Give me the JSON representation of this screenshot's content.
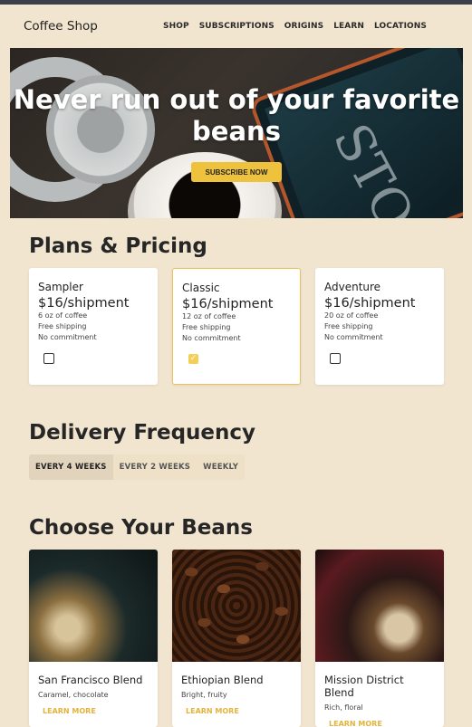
{
  "nav": {
    "brand": "Coffee Shop",
    "links": [
      "SHOP",
      "SUBSCRIPTIONS",
      "ORIGINS",
      "LEARN",
      "LOCATIONS"
    ]
  },
  "hero": {
    "headline": "Never run out of your favorite beans",
    "cta": "SUBSCRIBE NOW",
    "chalk_text": "WHAT'S YOUR STORY"
  },
  "plans": {
    "title": "Plans & Pricing",
    "items": [
      {
        "name": "Sampler",
        "price": "$16/shipment",
        "features": [
          "6 oz of coffee",
          "Free shipping",
          "No commitment"
        ],
        "selected": false
      },
      {
        "name": "Classic",
        "price": "$16/shipment",
        "features": [
          "12 oz of coffee",
          "Free shipping",
          "No commitment"
        ],
        "selected": true
      },
      {
        "name": "Adventure",
        "price": "$16/shipment",
        "features": [
          "20 oz of coffee",
          "Free shipping",
          "No commitment"
        ],
        "selected": false
      }
    ]
  },
  "frequency": {
    "title": "Delivery Frequency",
    "options": [
      "EVERY 4 WEEKS",
      "EVERY 2 WEEKS",
      "WEEKLY"
    ],
    "active": "EVERY 4 WEEKS"
  },
  "beans": {
    "title": "Choose Your Beans",
    "items": [
      {
        "name": "San Francisco Blend",
        "desc": "Caramel, chocolate",
        "link": "LEARN MORE"
      },
      {
        "name": "Ethiopian Blend",
        "desc": "Bright, fruity",
        "link": "LEARN MORE"
      },
      {
        "name": "Mission District Blend",
        "desc": "Rich, floral",
        "link": "LEARN MORE"
      }
    ]
  },
  "colors": {
    "background": "#f2e5d0",
    "accent": "#efc23d",
    "link_accent": "#e3b33d"
  }
}
